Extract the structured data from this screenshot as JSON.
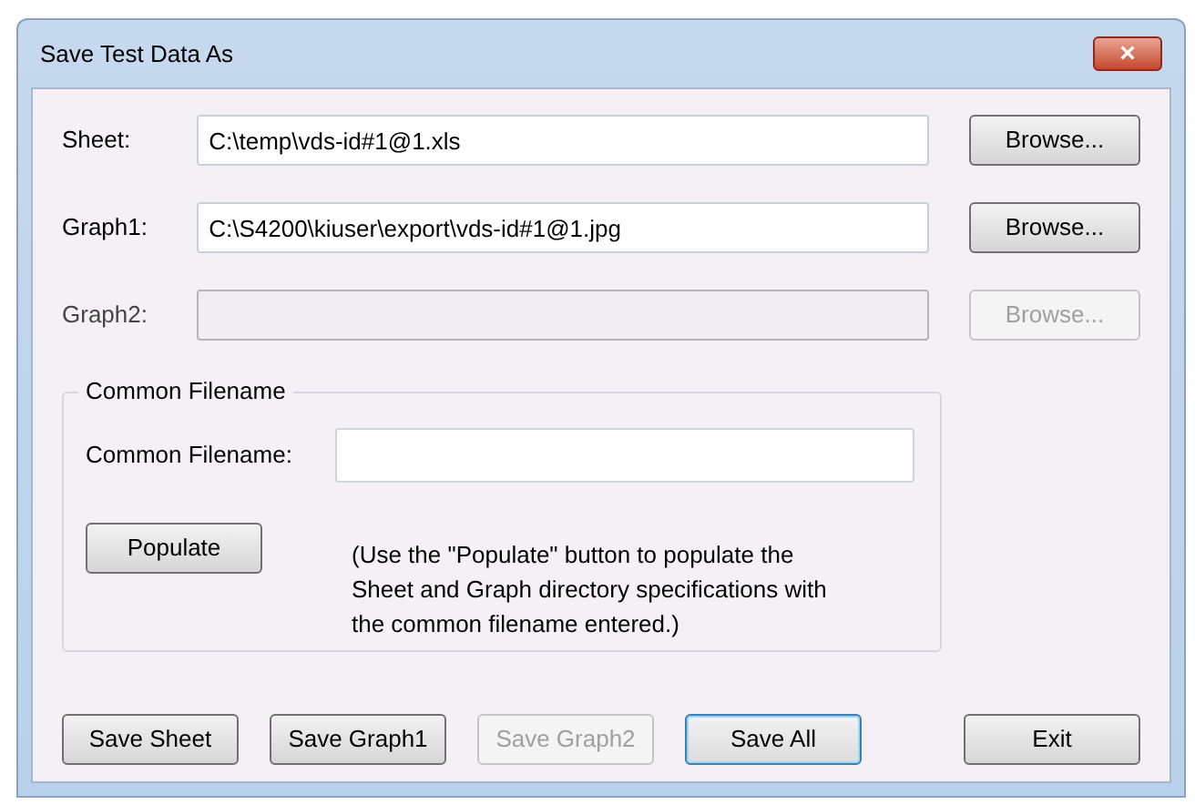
{
  "window": {
    "title": "Save Test Data As",
    "close": "×"
  },
  "fields": [
    {
      "label": "Sheet:",
      "value": "C:\\temp\\vds-id#1@1.xls",
      "disabled": false,
      "button": "Browse..."
    },
    {
      "label": "Graph1:",
      "value": "C:\\S4200\\kiuser\\export\\vds-id#1@1.jpg",
      "disabled": false,
      "button": "Browse..."
    },
    {
      "label": "Graph2:",
      "disabled": true,
      "button": "Browse..."
    }
  ],
  "group": {
    "legend": "Common Filename",
    "label": "Common Filename:",
    "button": "Populate",
    "note": "(Use the \"Populate\" button to populate the Sheet and Graph directory specifications with the common filename entered.)"
  },
  "buttons": [
    {
      "label": "Save Sheet",
      "disabled": false,
      "focused": false
    },
    {
      "label": "Save Graph1",
      "disabled": false,
      "focused": false
    },
    {
      "label": "Save Graph2",
      "disabled": true,
      "focused": false
    },
    {
      "label": "Save All",
      "disabled": false,
      "focused": true
    }
  ],
  "exit": "Exit"
}
